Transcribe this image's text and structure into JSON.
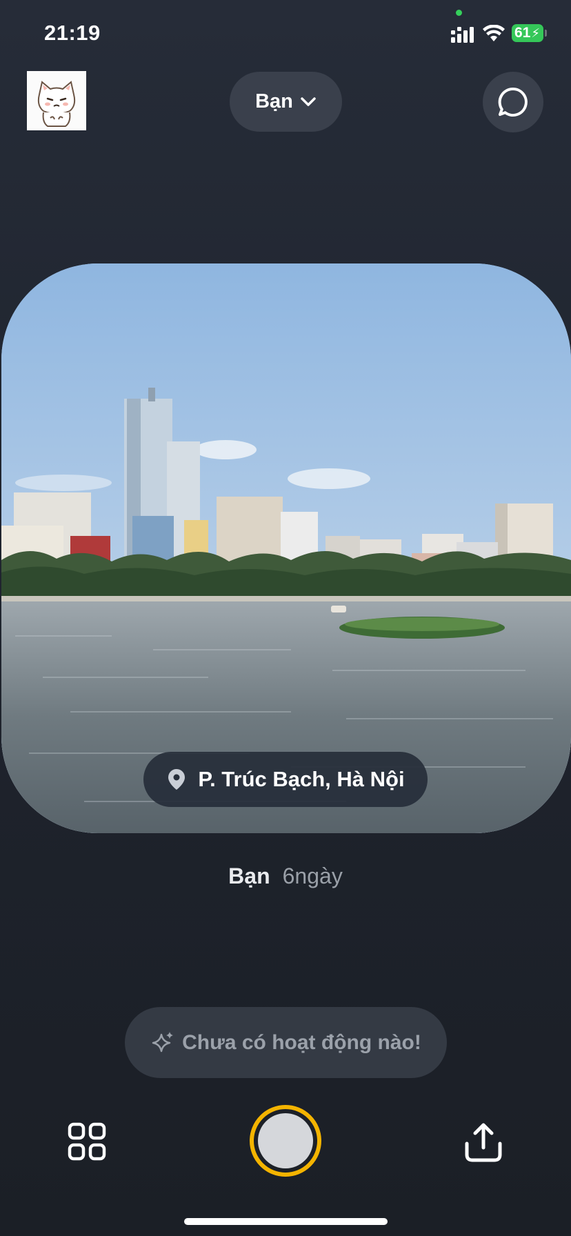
{
  "status_bar": {
    "time": "21:19",
    "battery_level": "61",
    "battery_charging": true,
    "icons": [
      "signal-icon",
      "wifi-icon",
      "battery-icon"
    ]
  },
  "header": {
    "filter_label": "Bạn",
    "filter_icon": "chevron-down-icon",
    "chat_icon": "chat-bubble-icon",
    "avatar_icon": "cat-sticker-avatar"
  },
  "photo": {
    "location": "P. Trúc Bạch, Hà Nội",
    "location_icon": "map-pin-icon"
  },
  "post": {
    "author": "Bạn",
    "age": "6ngày"
  },
  "activity": {
    "text": "Chưa có hoạt động nào!",
    "icon": "sparkles-icon"
  },
  "bottom_bar": {
    "left_icon": "grid-icon",
    "center": "shutter-button",
    "right_icon": "share-icon",
    "shutter_ring_color": "#f4b400"
  },
  "colors": {
    "background": "#232833",
    "pill": "#3a404c",
    "accent": "#f4b400",
    "battery": "#35c759"
  }
}
